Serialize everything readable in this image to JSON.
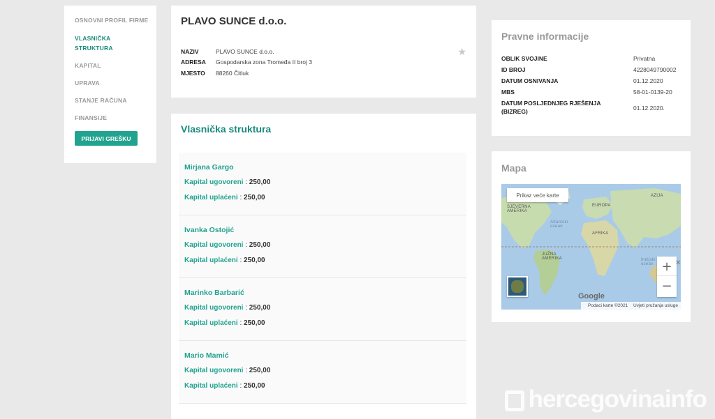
{
  "nav": {
    "items": [
      {
        "label": "OSNOVNI PROFIL FIRME",
        "active": false
      },
      {
        "label": "VLASNIČKA STRUKTURA",
        "active": true
      },
      {
        "label": "KAPITAL",
        "active": false
      },
      {
        "label": "UPRAVA",
        "active": false
      },
      {
        "label": "STANJE RAČUNA",
        "active": false
      },
      {
        "label": "FINANSIJE",
        "active": false
      }
    ],
    "report_button": "PRIJAVI GREŠKU"
  },
  "company": {
    "name": "PLAVO SUNCE d.o.o.",
    "rows": [
      {
        "label": "NAZIV",
        "value": "PLAVO SUNCE d.o.o."
      },
      {
        "label": "ADRESA",
        "value": "Gospodarska zona Tromeđa II broj 3"
      },
      {
        "label": "MJESTO",
        "value": "88260 Čitluk"
      }
    ]
  },
  "owners": {
    "title": "Vlasnička struktura",
    "list": [
      {
        "name": "Mirjana Gargo",
        "ugovoreni_label": "Kapital ugovoreni",
        "ugovoreni": "250,00",
        "uplaceni_label": "Kapital uplaćeni",
        "uplaceni": "250,00"
      },
      {
        "name": "Ivanka Ostojić",
        "ugovoreni_label": "Kapital ugovoreni",
        "ugovoreni": "250,00",
        "uplaceni_label": "Kapital uplaćeni",
        "uplaceni": "250,00"
      },
      {
        "name": "Marinko Barbarić",
        "ugovoreni_label": "Kapital ugovoreni",
        "ugovoreni": "250,00",
        "uplaceni_label": "Kapital uplaćeni",
        "uplaceni": "250,00"
      },
      {
        "name": "Mario Mamić",
        "ugovoreni_label": "Kapital ugovoreni",
        "ugovoreni": "250,00",
        "uplaceni_label": "Kapital uplaćeni",
        "uplaceni": "250,00"
      }
    ]
  },
  "legal": {
    "title": "Pravne informacije",
    "rows": [
      {
        "label": "OBLIK SVOJINE",
        "value": "Privatna"
      },
      {
        "label": "ID BROJ",
        "value": "4228049790002"
      },
      {
        "label": "DATUM OSNIVANJA",
        "value": "01.12.2020"
      },
      {
        "label": "MBS",
        "value": "58-01-0139-20"
      },
      {
        "label": "DATUM POSLJEDNJEG RJEŠENJA (BIZREG)",
        "value": "01.12.2020."
      }
    ]
  },
  "map": {
    "title": "Mapa",
    "larger_map": "Prikaz veće karte",
    "labels": {
      "north_america": "SJEVERNA AMERIKA",
      "atlantic": "Atlantski ocean",
      "europe": "EUROPA",
      "asia": "AZIJA",
      "africa": "AFRIKA",
      "south_america": "JUŽNA AMERIKA",
      "indian": "Indijski ocean"
    },
    "zoom_in": "+",
    "zoom_out": "−",
    "logo": "Google",
    "data_credit": "Podaci karte ©2021",
    "terms": "Uvjeti pružanja usluge",
    "icons": {
      "star": "star-icon",
      "close": "close-icon"
    }
  },
  "watermark": "hercegovinainfo",
  "colors": {
    "accent": "#21a38f",
    "accent_dark": "#1a8a7c",
    "background": "#e9e9e9",
    "muted": "#9a9a9a"
  }
}
